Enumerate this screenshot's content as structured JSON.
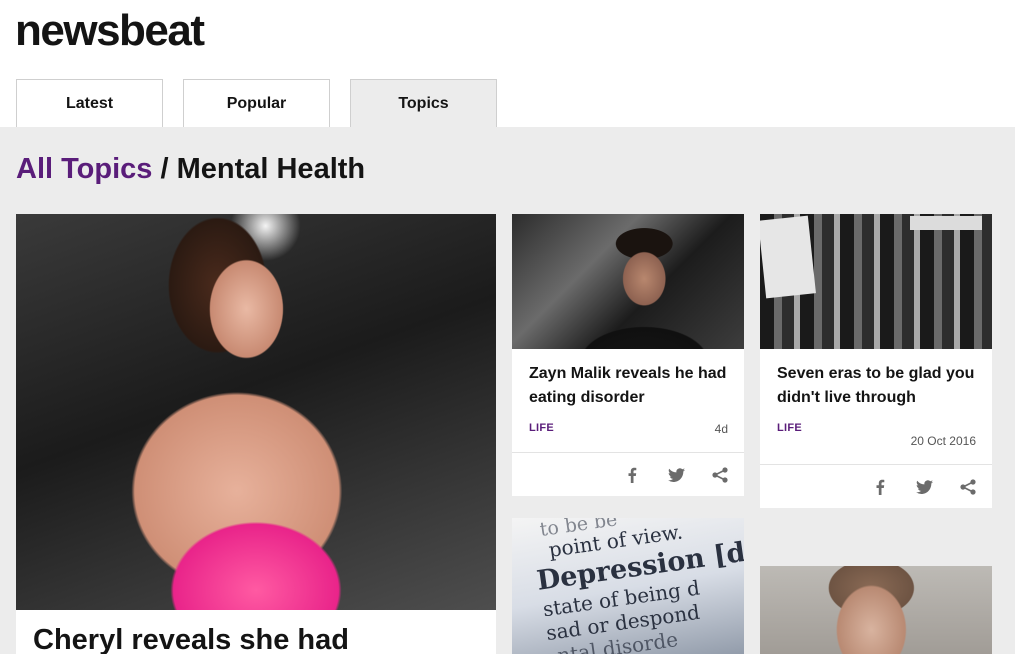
{
  "site": {
    "logo": "newsbeat"
  },
  "tabs": [
    {
      "label": "Latest",
      "active": false
    },
    {
      "label": "Popular",
      "active": false
    },
    {
      "label": "Topics",
      "active": true
    }
  ],
  "breadcrumb": {
    "parent": "All Topics",
    "separator": " / ",
    "current": "Mental Health"
  },
  "stories": {
    "featured": {
      "title": "Cheryl reveals she had",
      "image_desc": "woman"
    },
    "zayn": {
      "title": "Zayn Malik reveals he had eating disorder",
      "tag": "LIFE",
      "time": "4d"
    },
    "eras": {
      "title": "Seven eras to be glad you didn't live through",
      "tag": "LIFE",
      "time": "20 Oct 2016"
    },
    "depression": {
      "image_text": [
        "to be be",
        "point of view.",
        "Depression [dɪ",
        "state of being d",
        "sad or despond",
        "ntal disorde"
      ]
    },
    "man": {
      "image_desc": "man"
    }
  },
  "share_icons": [
    "facebook-icon",
    "twitter-icon",
    "share-icon"
  ],
  "colors": {
    "accent": "#5a1d7a",
    "background": "#ececec",
    "text": "#141414"
  }
}
